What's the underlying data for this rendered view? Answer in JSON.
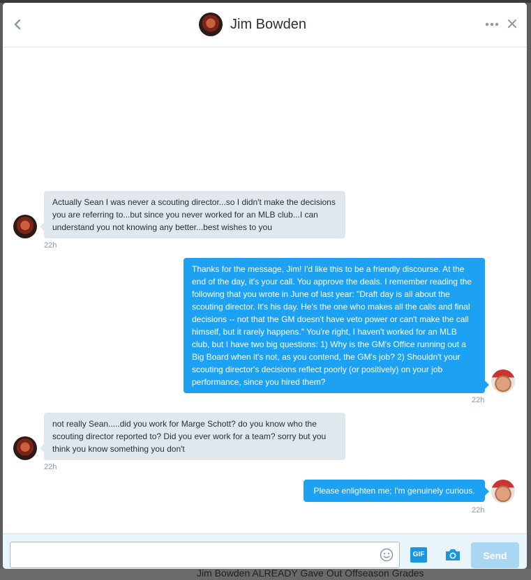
{
  "background": {
    "peek_text": "Jim Bowden ALREADY Gave Out Offseason Grades"
  },
  "header": {
    "back_icon": "chevron-left-icon",
    "title": "Jim Bowden",
    "more_icon": "more-dots-icon",
    "close_icon": "close-icon"
  },
  "messages": [
    {
      "sender": "Jim Bowden",
      "direction": "incoming",
      "text": "Actually Sean I was never a scouting director...so I didn't make the decisions you are referring to...but since you never worked for an MLB club...I can understand you not knowing any better...best wishes to you",
      "time": "22h"
    },
    {
      "sender": "me",
      "direction": "outgoing",
      "text": "Thanks for the message, Jim!  I'd like this to be a friendly discourse.  At the end of the day, it's your call. You approve the deals.  I remember reading the following that you wrote in June of last year: \"Draft day is all about the scouting director. It's his day. He's the one who makes all the calls and final decisions -- not that the GM doesn't have veto power or can't make the call himself, but it rarely happens.\"  You're right, I haven't worked for an MLB club, but I have two big questions: 1) Why is the GM's Office running out a Big Board when it's not, as you contend, the GM's job? 2) Shouldn't your scouting director's decisions reflect poorly (or positively) on your job performance, since you hired them?",
      "time": "22h"
    },
    {
      "sender": "Jim Bowden",
      "direction": "incoming",
      "text": "not really Sean.....did you work for Marge Schott? do you know who the scouting director reported to? Did you ever work for a team? sorry but you think you know something you don't",
      "time": "22h"
    },
    {
      "sender": "me",
      "direction": "outgoing",
      "text": "Please enlighten me; I'm genuinely curious.",
      "time": "22h"
    }
  ],
  "composer": {
    "input_value": "",
    "input_placeholder": "",
    "emoji_icon": "emoji-icon",
    "gif_label": "GIF",
    "camera_icon": "camera-icon",
    "send_label": "Send"
  },
  "colors": {
    "outgoing_bubble": "#1da1f2",
    "incoming_bubble": "#e1e8ed",
    "send_button_disabled": "#a9d6f3",
    "composer_bg": "#e8f5fd"
  }
}
